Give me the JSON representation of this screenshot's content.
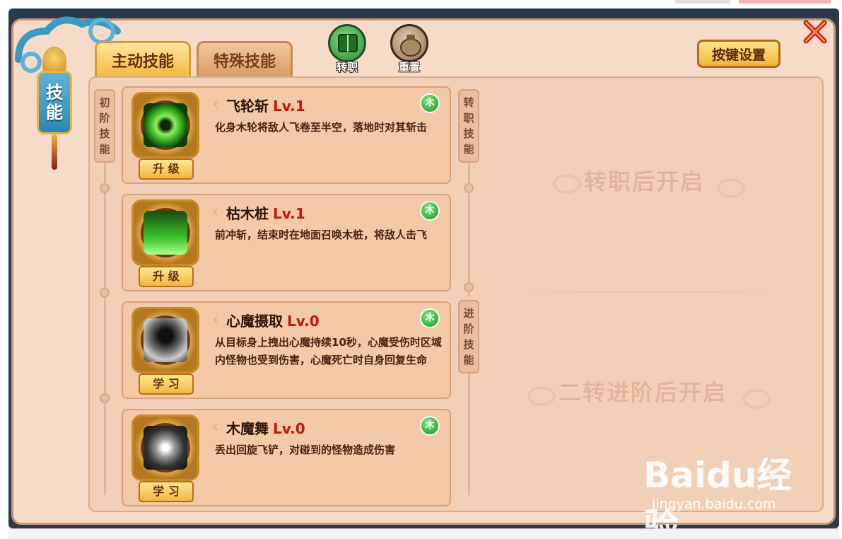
{
  "banner": {
    "title_line1": "技",
    "title_line2": "能"
  },
  "tabs": [
    {
      "label": "主动技能",
      "active": true
    },
    {
      "label": "特殊技能",
      "active": false
    }
  ],
  "top_buttons": [
    {
      "label": "转职",
      "icon": "book-icon"
    },
    {
      "label": "重置",
      "icon": "pot-icon"
    }
  ],
  "keyset_label": "按键设置",
  "sections": {
    "basic": {
      "label": [
        "初",
        "阶",
        "技",
        "能"
      ]
    },
    "job": {
      "label": [
        "转",
        "职",
        "技",
        "能"
      ],
      "locked_text": "转职后开启"
    },
    "advanced": {
      "label": [
        "进",
        "阶",
        "技",
        "能"
      ],
      "locked_text": "二转进阶后开启"
    }
  },
  "skills": [
    {
      "name": "飞轮斩",
      "level": "Lv.1",
      "desc": "化身木轮将敌人飞卷至半空，落地时对其斩击",
      "button": "升 级",
      "element": "木",
      "icon": "green-vortex-icon"
    },
    {
      "name": "枯木桩",
      "level": "Lv.1",
      "desc": "前冲斩，结束时在地面召唤木桩，将敌人击飞",
      "button": "升 级",
      "element": "木",
      "icon": "wooden-stakes-icon"
    },
    {
      "name": "心魔摄取",
      "level": "Lv.0",
      "desc": "从目标身上拽出心魔持续10秒，心魔受伤时区域内怪物也受到伤害，心魔死亡时自身回复生命",
      "button": "学 习",
      "element": "木",
      "icon": "shadow-demon-icon"
    },
    {
      "name": "木魔舞",
      "level": "Lv.0",
      "desc": "丢出回旋飞铲，对碰到的怪物造成伤害",
      "button": "学 习",
      "element": "木",
      "icon": "spinning-blade-icon"
    }
  ],
  "watermark": {
    "main": "Baidu经验",
    "sub": "jingyan.baidu.com"
  },
  "colors": {
    "level_red": "#c0170e",
    "element_green": "#1b8b26",
    "tab_gold": "#f3b842"
  }
}
